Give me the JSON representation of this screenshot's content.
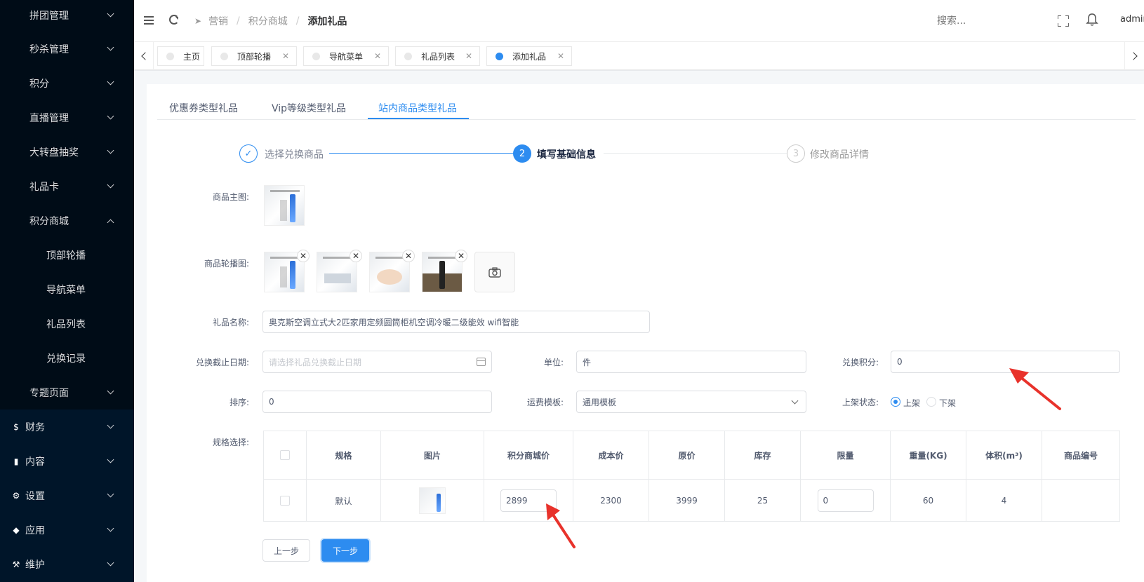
{
  "sidebar": {
    "items": [
      {
        "label": "拼团管理",
        "top": 0
      },
      {
        "label": "秒杀管理"
      },
      {
        "label": "积分"
      },
      {
        "label": "直播管理"
      },
      {
        "label": "大转盘抽奖"
      },
      {
        "label": "礼品卡"
      },
      {
        "label": "积分商城"
      },
      {
        "label": "顶部轮播"
      },
      {
        "label": "导航菜单"
      },
      {
        "label": "礼品列表"
      },
      {
        "label": "兑换记录"
      },
      {
        "label": "专题页面"
      },
      {
        "label": "财务",
        "icon": "dollar-icon"
      },
      {
        "label": "内容",
        "icon": "book-icon"
      },
      {
        "label": "设置",
        "icon": "gear-icon"
      },
      {
        "label": "应用",
        "icon": "cube-icon"
      },
      {
        "label": "维护",
        "icon": "hammer-icon"
      }
    ]
  },
  "header": {
    "breadcrumb": [
      "营销",
      "积分商城",
      "添加礼品"
    ],
    "search_placeholder": "搜索...",
    "user": "admin"
  },
  "tabs": [
    {
      "label": "主页"
    },
    {
      "label": "顶部轮播"
    },
    {
      "label": "导航菜单"
    },
    {
      "label": "礼品列表"
    },
    {
      "label": "添加礼品",
      "active": true
    }
  ],
  "gift_type_tabs": [
    "优惠券类型礼品",
    "Vip等级类型礼品",
    "站内商品类型礼品"
  ],
  "steps": [
    {
      "title": "选择兑换商品",
      "mark": "✓"
    },
    {
      "title": "填写基础信息",
      "mark": "2"
    },
    {
      "title": "修改商品详情",
      "mark": "3"
    }
  ],
  "form": {
    "main_image_label": "商品主图:",
    "carousel_label": "商品轮播图:",
    "name_label": "礼品名称:",
    "name_value": "奥克斯空调立式大2匹家用定频圆筒柜机空调冷暖二级能效 wifi智能",
    "deadline_label": "兑换截止日期:",
    "deadline_placeholder": "请选择礼品兑换截止日期",
    "unit_label": "单位:",
    "unit_value": "件",
    "points_label": "兑换积分:",
    "points_value": "0",
    "sort_label": "排序:",
    "sort_value": "0",
    "shipping_label": "运费模板:",
    "shipping_value": "通用模板",
    "status_label": "上架状态:",
    "status_on": "上架",
    "status_off": "下架",
    "spec_label": "规格选择:"
  },
  "spec_table": {
    "headers": [
      "规格",
      "图片",
      "积分商城价",
      "成本价",
      "原价",
      "库存",
      "限量",
      "重量(KG)",
      "体积(m³)",
      "商品编号"
    ],
    "row": {
      "spec": "默认",
      "points_price": "2899",
      "cost": "2300",
      "original": "3999",
      "stock": "25",
      "limit": "0",
      "weight": "60",
      "volume": "4",
      "code": ""
    }
  },
  "buttons": {
    "prev": "上一步",
    "next": "下一步"
  },
  "colors": {
    "primary": "#2d8cf0",
    "sidebar": "#001529",
    "annotation": "#e8322b"
  }
}
